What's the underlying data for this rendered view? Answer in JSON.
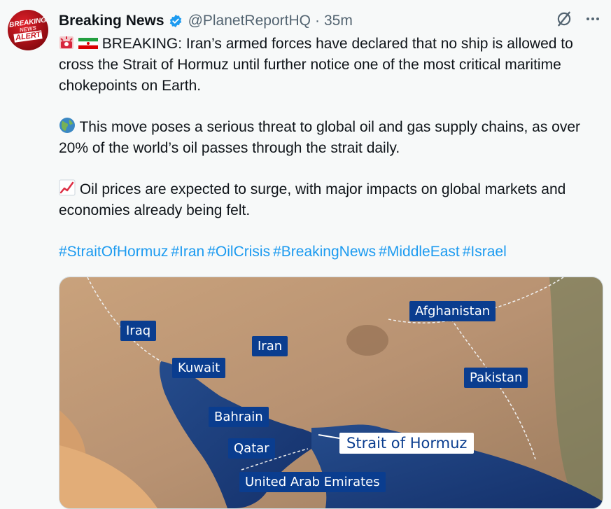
{
  "account": {
    "avatar_text": [
      "BREAKING",
      "NEWS",
      "ALERT"
    ],
    "name": "Breaking News",
    "handle": "@PlanetReportHQ",
    "separator": "·",
    "time": "35m"
  },
  "tweet": {
    "para1": "BREAKING: Iran’s armed forces have declared that no ship is allowed to cross the Strait of Hormuz until further notice one of the most critical maritime chokepoints on Earth.",
    "para2": "This move poses a serious threat to global oil and gas supply chains, as over 20% of the world’s oil passes through the strait daily.",
    "para3": "Oil prices are expected to surge, with major impacts on global markets and economies already being felt.",
    "hashtags": [
      "#StraitOfHormuz",
      "#Iran",
      "#OilCrisis",
      "#BreakingNews",
      "#MiddleEast",
      "#Israel"
    ]
  },
  "map": {
    "labels": {
      "iraq": "Iraq",
      "kuwait": "Kuwait",
      "iran": "Iran",
      "afghanistan": "Afghanistan",
      "pakistan": "Pakistan",
      "bahrain": "Bahrain",
      "qatar": "Qatar",
      "uae": "United Arab Emirates",
      "strait": "Strait of Hormuz"
    }
  },
  "icons": [
    "grok-icon",
    "more-icon",
    "verified-badge-icon",
    "siren-emoji-icon",
    "iran-flag-icon",
    "globe-emoji-icon",
    "chart-up-emoji-icon"
  ],
  "colors": {
    "link": "#1d9bf0",
    "label_bg": "#0a3d8f",
    "verified": "#1d9bf0"
  }
}
